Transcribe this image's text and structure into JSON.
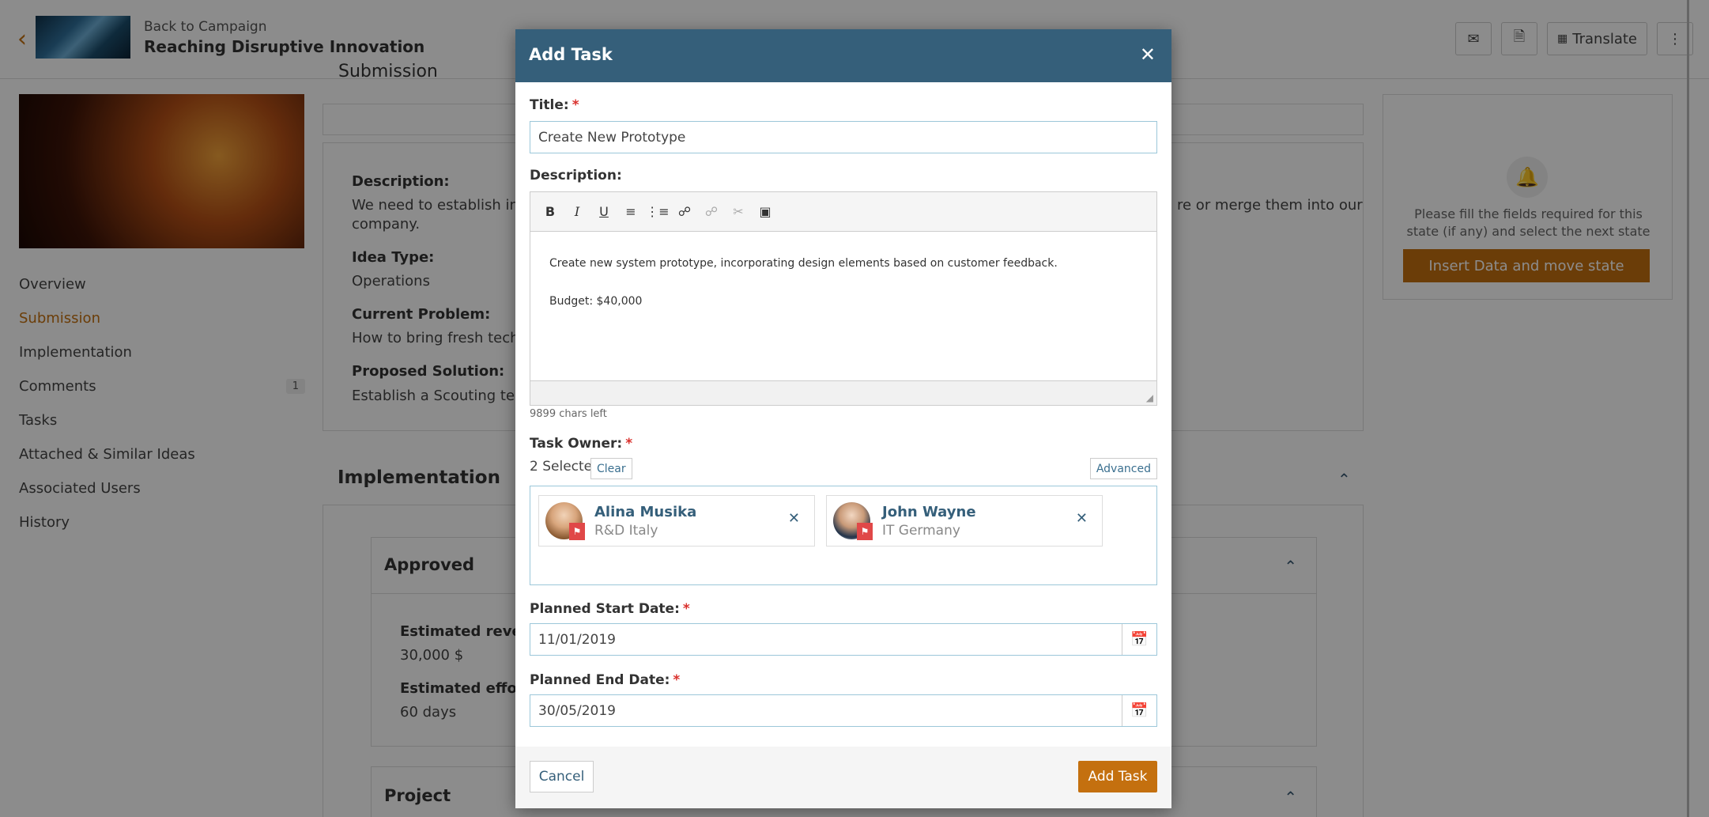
{
  "header": {
    "back_label": "Back to Campaign",
    "campaign_title": "Reaching Disruptive Innovation",
    "translate_label": "Translate"
  },
  "section_head": "Submission",
  "side_nav": {
    "items": [
      {
        "label": "Overview"
      },
      {
        "label": "Submission",
        "active": true
      },
      {
        "label": "Implementation"
      },
      {
        "label": "Comments",
        "badge": "1"
      },
      {
        "label": "Tasks"
      },
      {
        "label": "Attached & Similar Ideas"
      },
      {
        "label": "Associated Users"
      },
      {
        "label": "History"
      }
    ]
  },
  "submission": {
    "description_label": "Description:",
    "description_value_left": "We need to establish innov",
    "description_value_left2": "company.",
    "description_value_right": "re or merge them into our",
    "idea_type_label": "Idea Type:",
    "idea_type_value": "Operations",
    "current_problem_label": "Current Problem:",
    "current_problem_value": "How to bring fresh technol",
    "proposed_solution_label": "Proposed Solution:",
    "proposed_solution_value": "Establish a Scouting team f"
  },
  "implementation": {
    "title": "Implementation",
    "approved_title": "Approved",
    "est_revenue_label": "Estimated revenu",
    "est_revenue_value": "30,000 $",
    "est_efforts_label": "Estimated efforts",
    "est_efforts_value": "60 days",
    "project_title": "Project"
  },
  "state_panel": {
    "message": "Please fill the fields required for this state (if any) and select the next state",
    "button_label": "Insert Data and move state"
  },
  "modal": {
    "title": "Add Task",
    "title_label": "Title:",
    "title_value": "Create New Prototype",
    "description_label": "Description:",
    "description_lines": [
      "Create new system prototype, incorporating design elements based on customer feedback.",
      "Budget: $40,000"
    ],
    "chars_left": "9899 chars left",
    "task_owner_label": "Task Owner:",
    "selected_count": "2 Selected",
    "clear_label": "Clear",
    "advanced_label": "Advanced",
    "owners": [
      {
        "name": "Alina Musika",
        "dept": "R&D Italy"
      },
      {
        "name": "John Wayne",
        "dept": "IT Germany"
      }
    ],
    "start_date_label": "Planned Start Date:",
    "start_date_value": "11/01/2019",
    "end_date_label": "Planned End Date:",
    "end_date_value": "30/05/2019",
    "cancel_label": "Cancel",
    "add_label": "Add Task"
  },
  "icons": {
    "close": "close-icon",
    "bell": "bell-icon",
    "calendar": "calendar-icon",
    "email": "email-icon",
    "pdf": "pdf-icon",
    "translate": "translate-icon",
    "more": "more-vertical-icon"
  },
  "colors": {
    "accent": "#c4700f",
    "modal_header": "#355f7a",
    "required": "#d9302c"
  }
}
